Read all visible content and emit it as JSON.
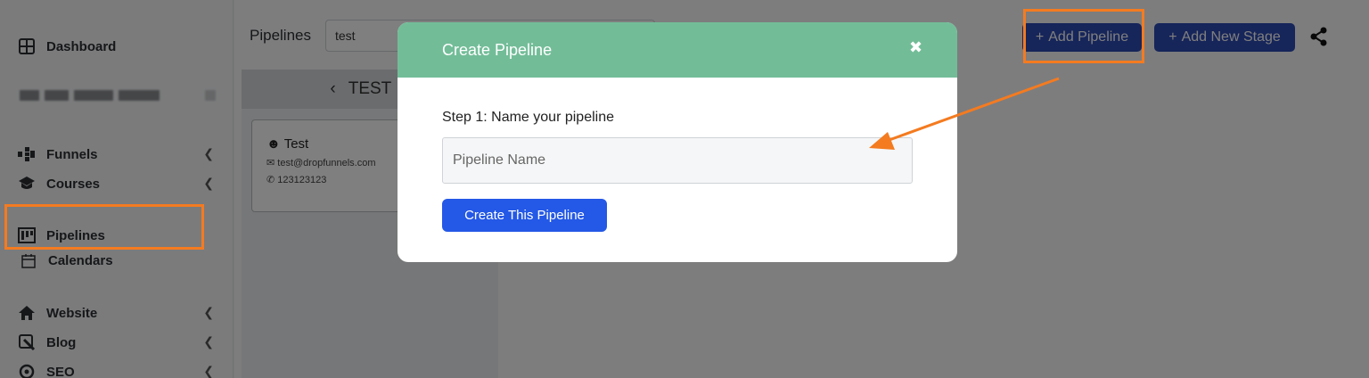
{
  "sidebar": {
    "items": [
      {
        "label": "Dashboard",
        "icon": "dashboard-icon"
      },
      {
        "label": "Funnels",
        "icon": "funnels-icon"
      },
      {
        "label": "Courses",
        "icon": "courses-icon"
      },
      {
        "label": "Pipelines",
        "icon": "pipelines-icon"
      },
      {
        "label": "Calendars",
        "icon": "calendar-icon"
      },
      {
        "label": "Website",
        "icon": "home-icon"
      },
      {
        "label": "Blog",
        "icon": "blog-icon"
      },
      {
        "label": "SEO",
        "icon": "seo-icon"
      }
    ]
  },
  "header": {
    "pipelines_label": "Pipelines",
    "selected_pipeline": "test",
    "add_pipeline_label": "Add Pipeline",
    "add_stage_label": "Add New Stage"
  },
  "board": {
    "stage_name": "TEST",
    "card": {
      "name": "Test",
      "email": "test@dropfunnels.com",
      "phone": "123123123"
    }
  },
  "modal": {
    "title": "Create Pipeline",
    "close_glyph": "✖",
    "step_label": "Step 1: Name your pipeline",
    "input_placeholder": "Pipeline Name",
    "input_value": "",
    "submit_label": "Create This Pipeline"
  },
  "colors": {
    "modal_header": "#72bd98",
    "primary_button": "#2458e6",
    "header_button": "#2d4ab5",
    "annotation": "#f47b20"
  }
}
